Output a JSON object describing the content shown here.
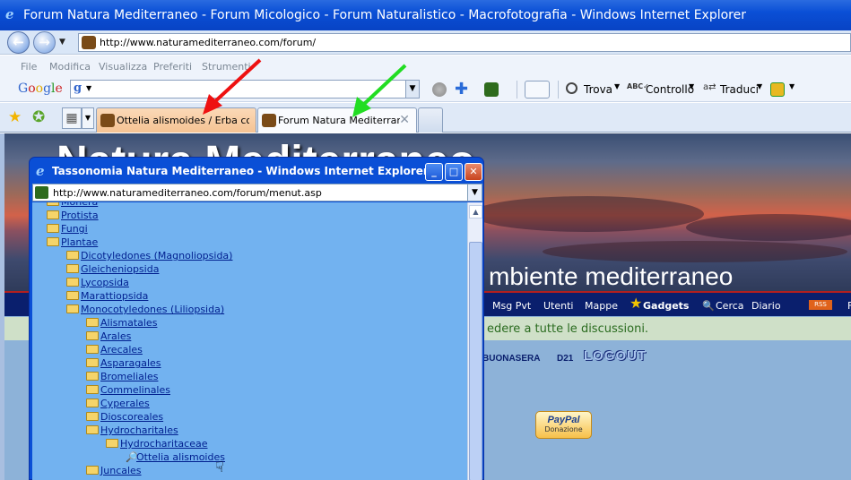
{
  "window": {
    "title": "Forum Natura Mediterraneo - Forum Micologico - Forum Naturalistico - Macrofotografia - Windows Internet Explorer"
  },
  "address_bar": {
    "url": "http://www.naturamediterraneo.com/forum/"
  },
  "menu": [
    "File",
    "Modifica",
    "Visualizza",
    "Preferiti",
    "Strumenti"
  ],
  "google_toolbar": {
    "logo": [
      "G",
      "o",
      "o",
      "g",
      "l",
      "e"
    ],
    "search_prefix": "g",
    "buttons": {
      "find": "Trova",
      "check": "Controllo",
      "translate": "Traduci"
    }
  },
  "tabs": [
    {
      "label": "Ottelia alismoides / Erba colt...",
      "active": false
    },
    {
      "label": "Forum Natura Mediterran...",
      "active": true
    }
  ],
  "site": {
    "title": "Natura Mediterraneo",
    "subtitle": "mbiente mediterraneo",
    "nav": [
      "Msg Pvt",
      "Utenti",
      "Mappe",
      "Gadgets",
      "Cerca",
      "Diario",
      "RSS",
      "F"
    ],
    "notice": "edere a tutte le discussioni.",
    "greeting": "BUONASERA",
    "user": "D21",
    "logout": "LOGOUT",
    "paypal": {
      "brand": "PayPal",
      "label": "Donazione"
    }
  },
  "popup": {
    "title": "Tassonomia Natura Mediterraneo - Windows Internet Explorer",
    "url": "http://www.naturamediterraneo.com/forum/menut.asp",
    "tree": [
      {
        "label": "Monera",
        "level": 0,
        "icon": "folder-closed"
      },
      {
        "label": "Protista",
        "level": 0,
        "icon": "folder-closed"
      },
      {
        "label": "Fungi",
        "level": 0,
        "icon": "folder-closed"
      },
      {
        "label": "Plantae",
        "level": 0,
        "icon": "folder-open"
      },
      {
        "label": "Dicotyledones (Magnoliopsida)",
        "level": 1,
        "icon": "folder-closed"
      },
      {
        "label": "Gleicheniopsida",
        "level": 1,
        "icon": "folder-closed"
      },
      {
        "label": "Lycopsida",
        "level": 1,
        "icon": "folder-closed"
      },
      {
        "label": "Marattiopsida",
        "level": 1,
        "icon": "folder-closed"
      },
      {
        "label": "Monocotyledones (Liliopsida)",
        "level": 1,
        "icon": "folder-open"
      },
      {
        "label": "Alismatales",
        "level": 2,
        "icon": "folder-closed"
      },
      {
        "label": "Arales",
        "level": 2,
        "icon": "folder-closed"
      },
      {
        "label": "Arecales",
        "level": 2,
        "icon": "folder-closed"
      },
      {
        "label": "Asparagales",
        "level": 2,
        "icon": "folder-closed"
      },
      {
        "label": "Bromeliales",
        "level": 2,
        "icon": "folder-closed"
      },
      {
        "label": "Commelinales",
        "level": 2,
        "icon": "folder-closed"
      },
      {
        "label": "Cyperales",
        "level": 2,
        "icon": "folder-closed"
      },
      {
        "label": "Dioscoreales",
        "level": 2,
        "icon": "folder-closed"
      },
      {
        "label": "Hydrocharitales",
        "level": 2,
        "icon": "folder-open"
      },
      {
        "label": "Hydrocharitaceae",
        "level": 3,
        "icon": "folder-open"
      },
      {
        "label": "Ottelia alismoides",
        "level": 4,
        "icon": "magnifier"
      },
      {
        "label": "Juncales",
        "level": 2,
        "icon": "folder-closed"
      }
    ]
  },
  "annotations": {
    "red_arrow_color": "#ee1111",
    "green_arrow_color": "#22dd22"
  }
}
